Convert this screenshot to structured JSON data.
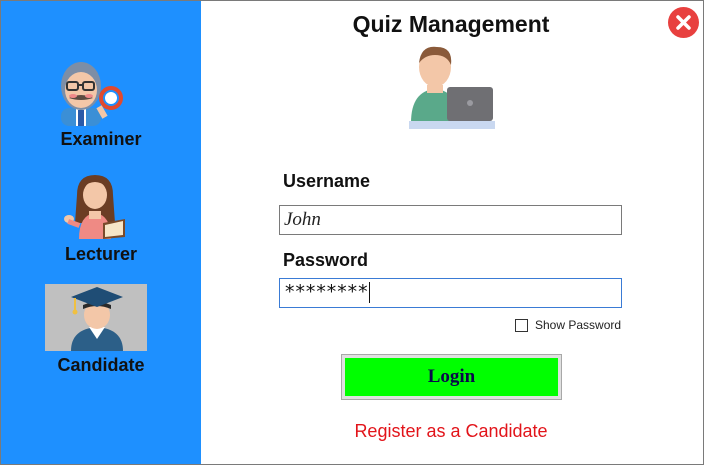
{
  "window": {
    "title": "Quiz Management",
    "close_icon": "close-icon"
  },
  "sidebar": {
    "background": "#1e90ff",
    "selected": "Candidate",
    "roles": [
      {
        "label": "Examiner",
        "icon": "examiner-icon"
      },
      {
        "label": "Lecturer",
        "icon": "lecturer-icon"
      },
      {
        "label": "Candidate",
        "icon": "candidate-graduate-icon"
      }
    ]
  },
  "header": {
    "illustration": "user-laptop-icon"
  },
  "form": {
    "username_label": "Username",
    "username_value": "John",
    "password_label": "Password",
    "password_value": "********",
    "show_password_label": "Show Password",
    "show_password_checked": false,
    "login_label": "Login",
    "login_color": "#00ff00",
    "register_link": "Register as a Candidate",
    "register_color": "#e2141a"
  }
}
